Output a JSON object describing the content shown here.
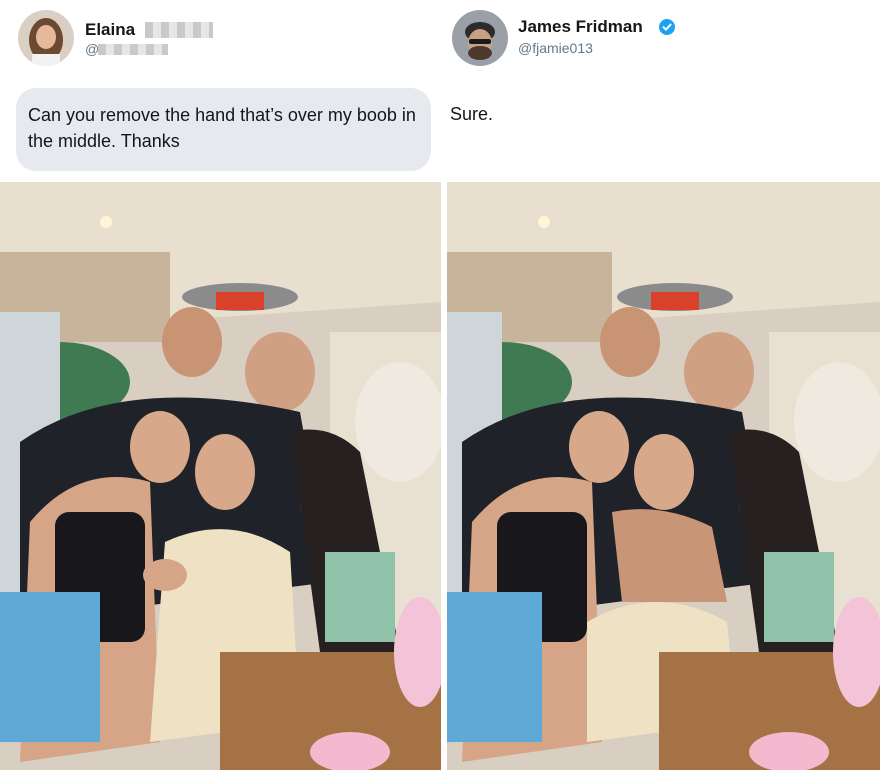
{
  "left_tweet": {
    "name": "Elaina",
    "handle": "@",
    "message": "Can you remove the hand that’s over my boob in the middle. Thanks"
  },
  "right_tweet": {
    "name": "James Fridman",
    "handle": "@fjamie013",
    "reply": "Sure."
  },
  "colors": {
    "bubble": "#e6e9ed",
    "verified": "#1da1f2",
    "handle": "#657786"
  },
  "icons": [
    "verified-badge-icon"
  ]
}
